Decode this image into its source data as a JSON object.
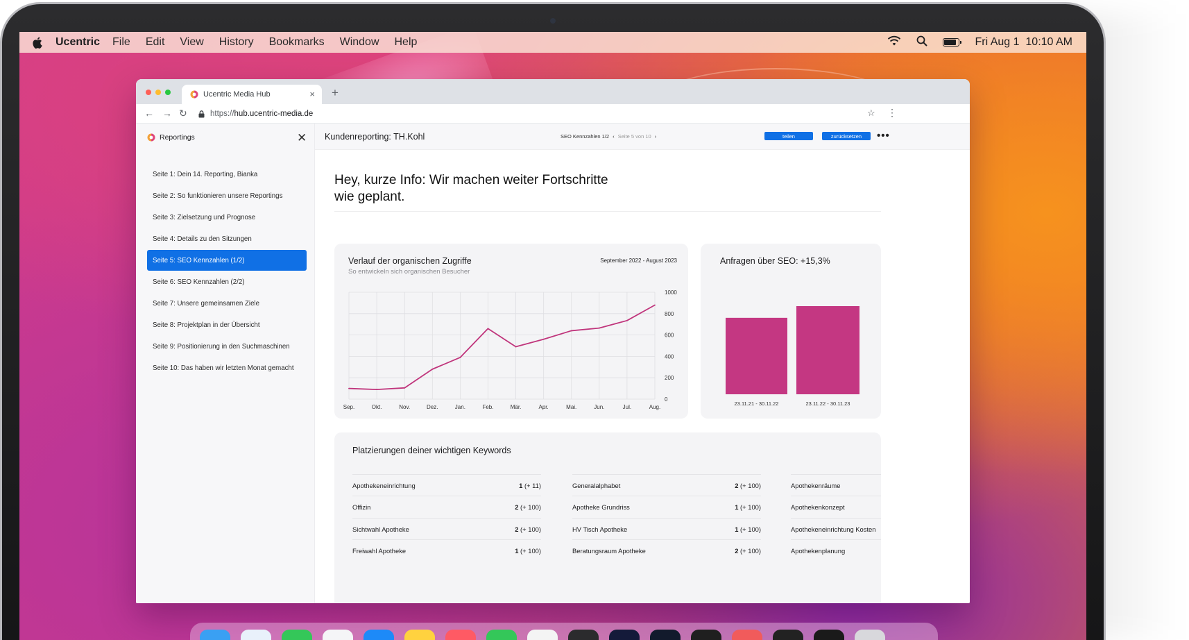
{
  "menubar": {
    "app_name": "Ucentric",
    "items": [
      "File",
      "Edit",
      "View",
      "History",
      "Bookmarks",
      "Window",
      "Help"
    ],
    "clock": "Fri Aug 1  10:10 AM"
  },
  "browser": {
    "tab_title": "Ucentric Media Hub",
    "tab_close": "×",
    "new_tab": "+",
    "url_scheme": "https://",
    "url_host": "hub.ucentric-media.de",
    "back": "←",
    "forward": "→",
    "reload": "↻",
    "bookmark": "☆",
    "menu": "⋮"
  },
  "sidebar": {
    "title": "Reportings",
    "close": "✕",
    "items": [
      "Seite 1: Dein 14. Reporting, Bianka",
      "Seite 2: So funktionieren unsere Reportings",
      "Seite 3: Zielsetzung und Prognose",
      "Seite 4: Details zu den Sitzungen",
      "Seite 5: SEO Kennzahlen (1/2)",
      "Seite 6: SEO Kennzahlen (2/2)",
      "Seite 7: Unsere gemeinsamen Ziele",
      "Seite 8: Projektplan in der Übersicht",
      "Seite 9: Positionierung in den Suchmaschinen",
      "Seite 10: Das haben wir letzten Monat gemacht"
    ],
    "active_index": 4
  },
  "content": {
    "title": "Kundenreporting: TH.Kohl",
    "pager_current": "SEO Kennzahlen 1/2",
    "pager_prev": "‹",
    "pager_page": "Seite 5 von 10",
    "pager_next": "›",
    "share_label": "teilen",
    "reset_label": "zurücksetzen",
    "more_label": "•••",
    "headline": "Hey, kurze Info: Wir machen weiter Fortschritte wie geplant."
  },
  "line_card": {
    "title": "Verlauf der organischen Zugriffe",
    "subtitle": "So entwickeln sich organischen Besucher",
    "range": "September 2022 - August 2023"
  },
  "bar_card": {
    "title": "Anfragen über SEO: +15,3%"
  },
  "chart_data": [
    {
      "type": "line",
      "title": "Verlauf der organischen Zugriffe",
      "subtitle": "So entwickeln sich organischen Besucher",
      "categories": [
        "Sep.",
        "Okt.",
        "Nov.",
        "Dez.",
        "Jan.",
        "Feb.",
        "Mär.",
        "Apr.",
        "Mai.",
        "Jun.",
        "Jul.",
        "Aug."
      ],
      "values": [
        100,
        90,
        105,
        280,
        390,
        660,
        490,
        560,
        640,
        665,
        735,
        880
      ],
      "ylim": [
        0,
        1000
      ],
      "yticks": [
        "0",
        "200",
        "400",
        "600",
        "800",
        "1000"
      ],
      "grid": true,
      "color": "#c0357c"
    },
    {
      "type": "bar",
      "title": "Anfragen über SEO: +15,3%",
      "categories": [
        "23.11.21 - 30.11.22",
        "23.11.22 - 30.11.23"
      ],
      "values": [
        100,
        115.3
      ],
      "color": "#c43782"
    }
  ],
  "keywords": {
    "title": "Platzierungen deiner wichtigen Keywords",
    "columns": [
      [
        {
          "name": "Apothekeneinrichtung",
          "rank": "1",
          "delta": "(+ 11)"
        },
        {
          "name": "Offizin",
          "rank": "2",
          "delta": "(+ 100)"
        },
        {
          "name": "Sichtwahl Apotheke",
          "rank": "2",
          "delta": "(+ 100)"
        },
        {
          "name": "Freiwahl Apotheke",
          "rank": "1",
          "delta": "(+ 100)"
        }
      ],
      [
        {
          "name": "Generalalphabet",
          "rank": "2",
          "delta": "(+ 100)"
        },
        {
          "name": "Apotheke Grundriss",
          "rank": "1",
          "delta": "(+ 100)"
        },
        {
          "name": "HV Tisch Apotheke",
          "rank": "1",
          "delta": "(+ 100)"
        },
        {
          "name": "Beratungsraum Apotheke",
          "rank": "2",
          "delta": "(+ 100)"
        }
      ],
      [
        {
          "name": "Apothekenräume",
          "rank": "",
          "delta": ""
        },
        {
          "name": "Apothekenkonzept",
          "rank": "",
          "delta": ""
        },
        {
          "name": "Apothekeneinrichtung Kosten",
          "rank": "",
          "delta": ""
        },
        {
          "name": "Apothekenplanung",
          "rank": "",
          "delta": ""
        }
      ]
    ]
  },
  "status": {
    "battery_level": 0.85
  },
  "colors": {
    "accent": "#1070e5",
    "chart": "#c0357c",
    "traffic_red": "#fe5f57",
    "traffic_yellow": "#febc2e",
    "traffic_green": "#28c840"
  },
  "dock_icons": [
    "finder-icon",
    "safari-icon",
    "messages-icon",
    "photos-icon",
    "appstore-icon",
    "notes-icon",
    "news-icon",
    "facetime-icon",
    "music-icon",
    "app-icon",
    "app-icon",
    "app-icon",
    "app-icon",
    "app-icon",
    "app-icon",
    "app-icon",
    "app-icon"
  ]
}
